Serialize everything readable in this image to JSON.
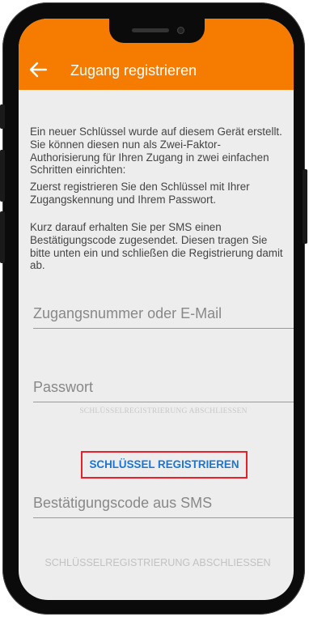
{
  "appbar": {
    "title": "Zugang registrieren",
    "back_icon": "arrow-left-icon",
    "color": "#f57c00"
  },
  "intro": {
    "paragraph1": "Ein neuer Schlüssel wurde auf diesem Gerät erstellt. Sie können diesen nun als Zwei-Faktor-Authorisierung für Ihren Zugang in zwei einfachen Schritten einrichten:",
    "paragraph2": "Zuerst registrieren Sie den Schlüssel mit Ihrer Zugangskennung und Ihrem Passwort.",
    "paragraph3": "Kurz darauf erhalten Sie per SMS einen Bestätigungscode zugesendet. Diesen tragen Sie bitte unten ein und schließen die Registrierung damit ab."
  },
  "form": {
    "username_placeholder": "Zugangsnummer oder E-Mail",
    "password_placeholder": "Passwort",
    "ghost_text": "SCHLÜSSELREGISTRIERUNG ABSCHLIESSEN",
    "register_button": "SCHLÜSSEL REGISTRIEREN",
    "code_placeholder": "Bestätigungscode aus SMS",
    "finish_button": "SCHLÜSSELREGISTRIERUNG ABSCHLIESSEN",
    "highlight_color": "#e8202a",
    "link_color": "#1976d2"
  }
}
